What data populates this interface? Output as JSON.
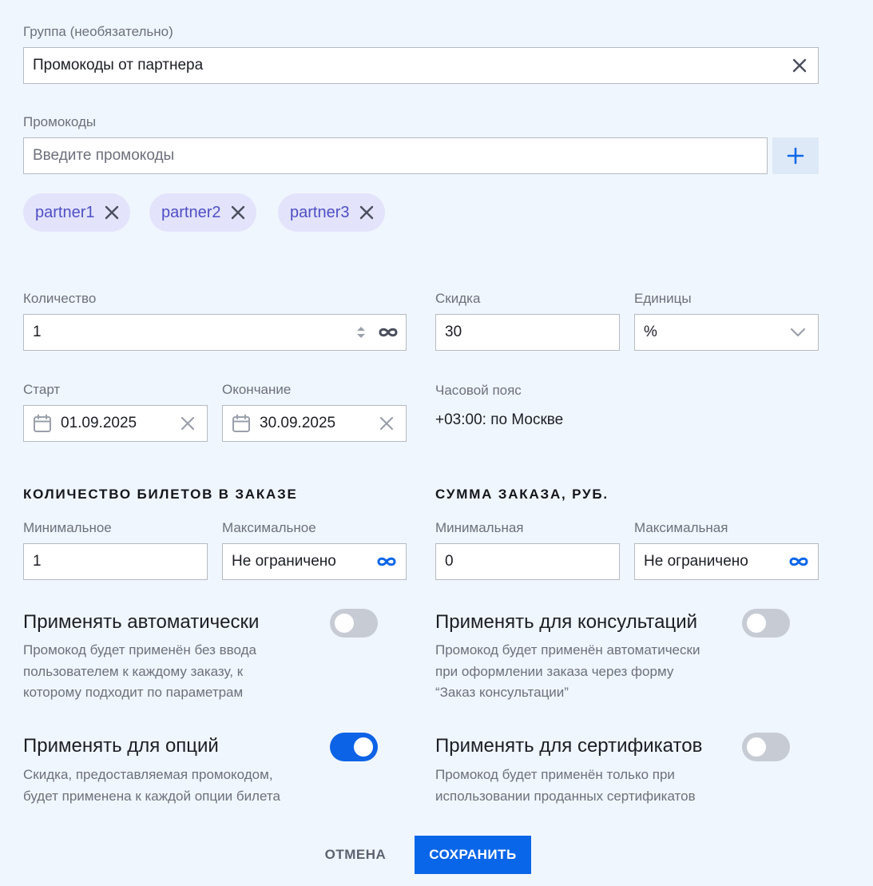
{
  "group": {
    "label": "Группа (необязательно)",
    "value": "Промокоды от партнера"
  },
  "promocodes": {
    "label": "Промокоды",
    "placeholder": "Введите промокоды",
    "chips": [
      "partner1",
      "partner2",
      "partner3"
    ]
  },
  "quantity": {
    "label": "Количество",
    "value": "1"
  },
  "discount": {
    "label": "Скидка",
    "value": "30"
  },
  "units": {
    "label": "Единицы",
    "value": "%"
  },
  "start": {
    "label": "Старт",
    "value": "01.09.2025"
  },
  "end": {
    "label": "Окончание",
    "value": "30.09.2025"
  },
  "timezone": {
    "label": "Часовой пояс",
    "value": "+03:00: по Москве"
  },
  "tickets": {
    "title": "КОЛИЧЕСТВО БИЛЕТОВ В ЗАКАЗЕ",
    "min_label": "Минимальное",
    "min_value": "1",
    "max_label": "Максимальное",
    "max_value": "Не ограничено"
  },
  "order_sum": {
    "title": "СУММА ЗАКАЗА, РУБ.",
    "min_label": "Минимальная",
    "min_value": "0",
    "max_label": "Максимальная",
    "max_value": "Не ограничено"
  },
  "toggles": {
    "auto": {
      "title": "Применять автоматически",
      "desc": [
        "Промокод будет применён без ввода",
        "пользователем к каждому заказу, к",
        "которому подходит по параметрам"
      ],
      "on": false
    },
    "consult": {
      "title": "Применять для консультаций",
      "desc": [
        "Промокод будет применён автоматически",
        "при оформлении заказа через форму",
        "“Заказ консультации”"
      ],
      "on": false
    },
    "options": {
      "title": "Применять для опций",
      "desc": [
        "Скидка, предоставляемая промокодом,",
        "будет применена к каждой опции билета"
      ],
      "on": true
    },
    "certs": {
      "title": "Применять для сертификатов",
      "desc": [
        "Промокод будет применён только при",
        "использовании проданных сертификатов"
      ],
      "on": false
    }
  },
  "actions": {
    "cancel": "ОТМЕНА",
    "save": "СОХРАНИТЬ"
  },
  "colors": {
    "accent": "#0a66e8",
    "background": "#f0f6fd",
    "chip_bg": "#e3e3fb",
    "chip_text": "#4f4fc5",
    "switch_off": "#c7cbd4"
  }
}
